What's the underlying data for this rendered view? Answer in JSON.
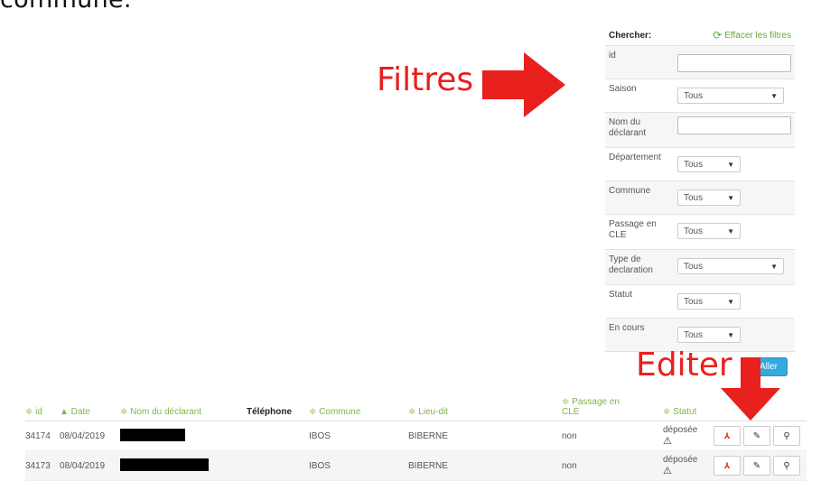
{
  "top_text": "commune.",
  "annotations": {
    "filtres": "Filtres",
    "editer": "Editer"
  },
  "filters": {
    "search_label": "Chercher:",
    "clear_label": "Effacer les filtres",
    "clear_icon": "refresh-icon",
    "rows": [
      {
        "label": "id",
        "type": "input",
        "value": ""
      },
      {
        "label": "Saison",
        "type": "select",
        "value": "Tous",
        "size": "wide"
      },
      {
        "label": "Nom du déclarant",
        "type": "input",
        "value": ""
      },
      {
        "label": "Département",
        "type": "select",
        "value": "Tous",
        "size": "narrow"
      },
      {
        "label": "Commune",
        "type": "select",
        "value": "Tous",
        "size": "narrow"
      },
      {
        "label": "Passage en CLE",
        "type": "select",
        "value": "Tous",
        "size": "narrow"
      },
      {
        "label": "Type de declaration",
        "type": "select",
        "value": "Tous",
        "size": "wide"
      },
      {
        "label": "Statut",
        "type": "select",
        "value": "Tous",
        "size": "narrow"
      },
      {
        "label": "En cours",
        "type": "select",
        "value": "Tous",
        "size": "narrow"
      }
    ],
    "submit_label": "Aller"
  },
  "table": {
    "headers": {
      "id": "≑ id",
      "date": "▲ Date",
      "nom": "≑ Nom du déclarant",
      "tel": "Téléphone",
      "commune": "≑ Commune",
      "lieu": "≑ Lieu-dit",
      "passage": "≑ Passage en CLE",
      "statut": "≑ Statut"
    },
    "rows": [
      {
        "id": "34174",
        "date": "08/04/2019",
        "commune": "IBOS",
        "lieu": "BIBERNE",
        "passage": "non",
        "statut": "déposée",
        "warning": "⚠"
      },
      {
        "id": "34173",
        "date": "08/04/2019",
        "commune": "IBOS",
        "lieu": "BIBERNE",
        "passage": "non",
        "statut": "déposée",
        "warning": "⚠"
      }
    ]
  },
  "colors": {
    "accent_green": "#7fb544",
    "annotation_red": "#e8201e",
    "button_blue": "#33a9dc"
  }
}
